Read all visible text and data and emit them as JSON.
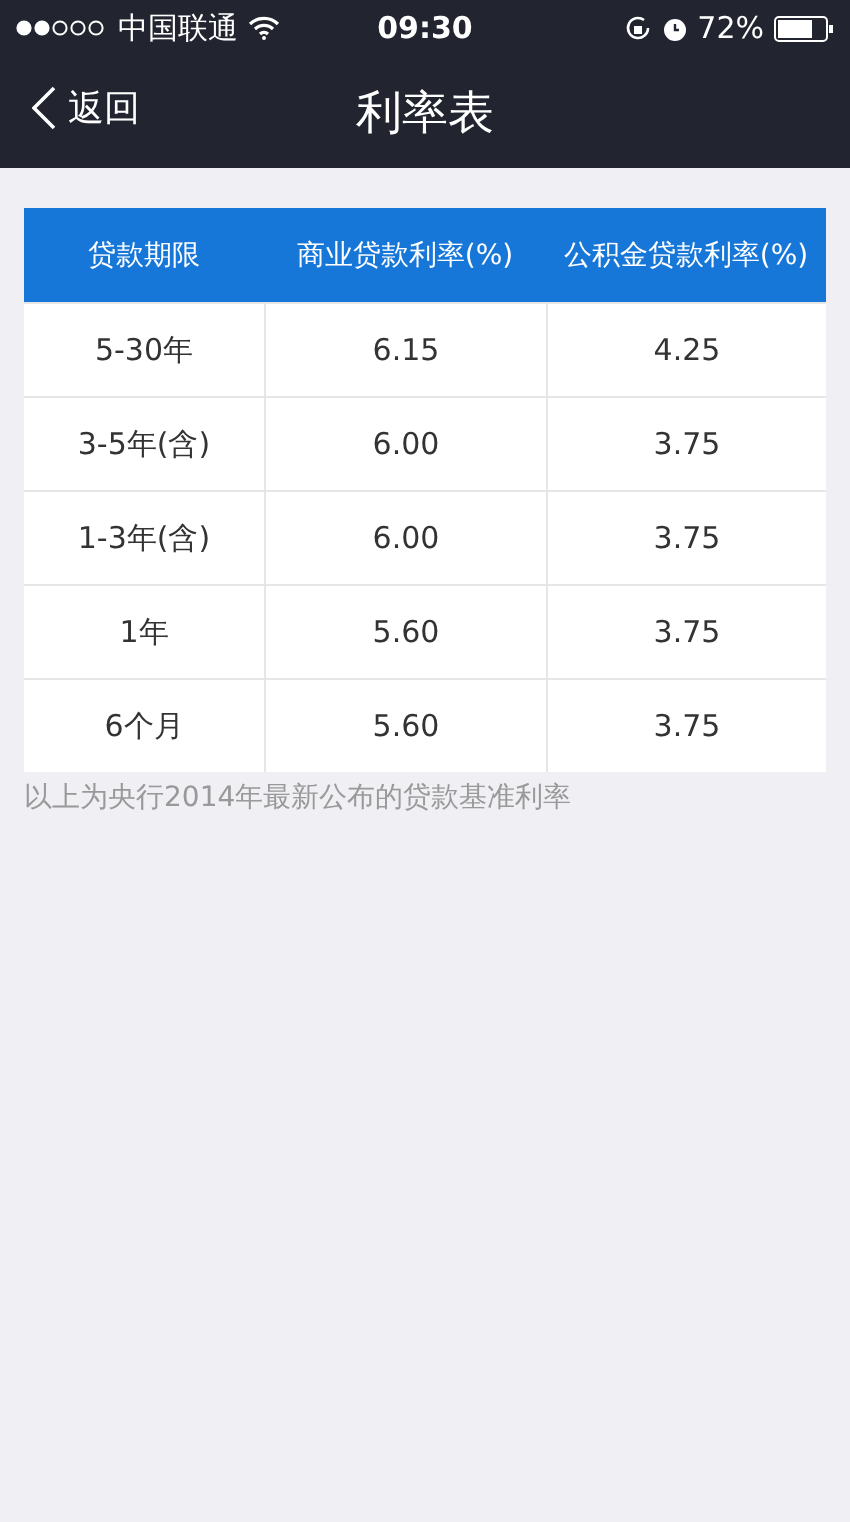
{
  "status_bar": {
    "carrier": "中国联通",
    "time": "09:30",
    "battery": "72%"
  },
  "nav_bar": {
    "back": "返回",
    "title": "利率表"
  },
  "table": {
    "columns": [
      "贷款期限",
      "商业贷款利率(%)",
      "公积金贷款利率(%)"
    ],
    "rows": [
      [
        "5-30年",
        "6.15",
        "4.25"
      ],
      [
        "3-5年(含)",
        "6.00",
        "3.75"
      ],
      [
        "1-3年(含)",
        "6.00",
        "3.75"
      ],
      [
        "1年",
        "5.60",
        "3.75"
      ],
      [
        "6个月",
        "5.60",
        "3.75"
      ]
    ]
  },
  "footnote": "以上为央行2014年最新公布的贷款基准利率"
}
